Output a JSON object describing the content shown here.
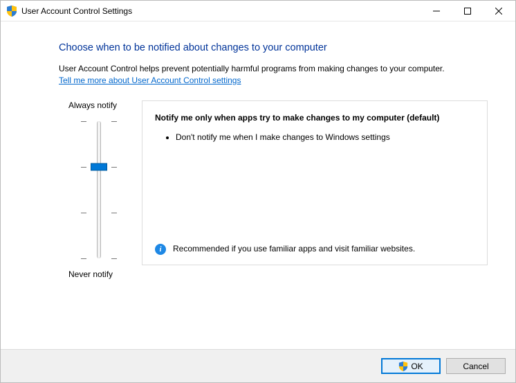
{
  "window": {
    "title": "User Account Control Settings"
  },
  "heading": "Choose when to be notified about changes to your computer",
  "description": "User Account Control helps prevent potentially harmful programs from making changes to your computer.",
  "link_text": "Tell me more about User Account Control settings",
  "slider": {
    "top_label": "Always notify",
    "bottom_label": "Never notify",
    "level_count": 4,
    "current_level_from_top": 1
  },
  "panel": {
    "title": "Notify me only when apps try to make changes to my computer (default)",
    "bullets": [
      "Don't notify me when I make changes to Windows settings"
    ],
    "footer": "Recommended if you use familiar apps and visit familiar websites."
  },
  "buttons": {
    "ok": "OK",
    "cancel": "Cancel"
  }
}
